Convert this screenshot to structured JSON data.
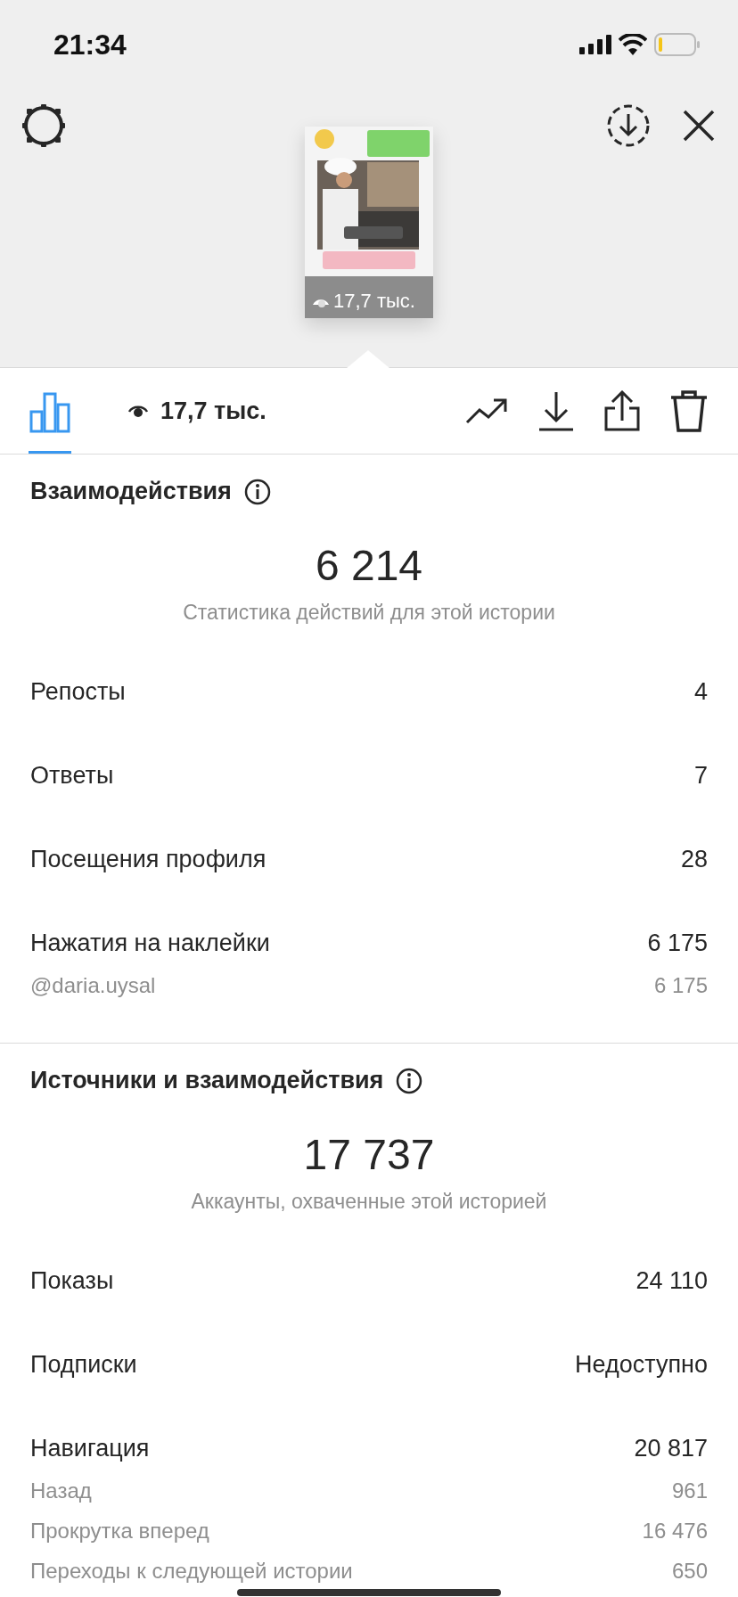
{
  "status_bar": {
    "time": "21:34"
  },
  "story": {
    "views": "17,7 тыс."
  },
  "toolbar": {
    "views": "17,7 тыс."
  },
  "sections": [
    {
      "title": "Взаимодействия",
      "total": "6 214",
      "subtitle": "Статистика действий для этой истории",
      "rows": [
        {
          "kind": "main",
          "label": "Репосты",
          "value": "4"
        },
        {
          "kind": "main",
          "label": "Ответы",
          "value": "7"
        },
        {
          "kind": "main",
          "label": "Посещения профиля",
          "value": "28"
        },
        {
          "kind": "main",
          "label": "Нажатия на наклейки",
          "value": "6 175"
        },
        {
          "kind": "sub",
          "label": "@daria.uysal",
          "value": "6 175"
        }
      ]
    },
    {
      "title": "Источники и взаимодействия",
      "total": "17 737",
      "subtitle": "Аккаунты, охваченные этой историей",
      "rows": [
        {
          "kind": "main",
          "label": "Показы",
          "value": "24 110"
        },
        {
          "kind": "main",
          "label": "Подписки",
          "value": "Недоступно"
        },
        {
          "kind": "main",
          "label": "Навигация",
          "value": "20 817"
        },
        {
          "kind": "sub",
          "label": "Назад",
          "value": "961"
        },
        {
          "kind": "sub",
          "label": "Прокрутка вперед",
          "value": "16 476"
        },
        {
          "kind": "sub",
          "label": "Переходы к следующей истории",
          "value": "650"
        }
      ]
    }
  ]
}
